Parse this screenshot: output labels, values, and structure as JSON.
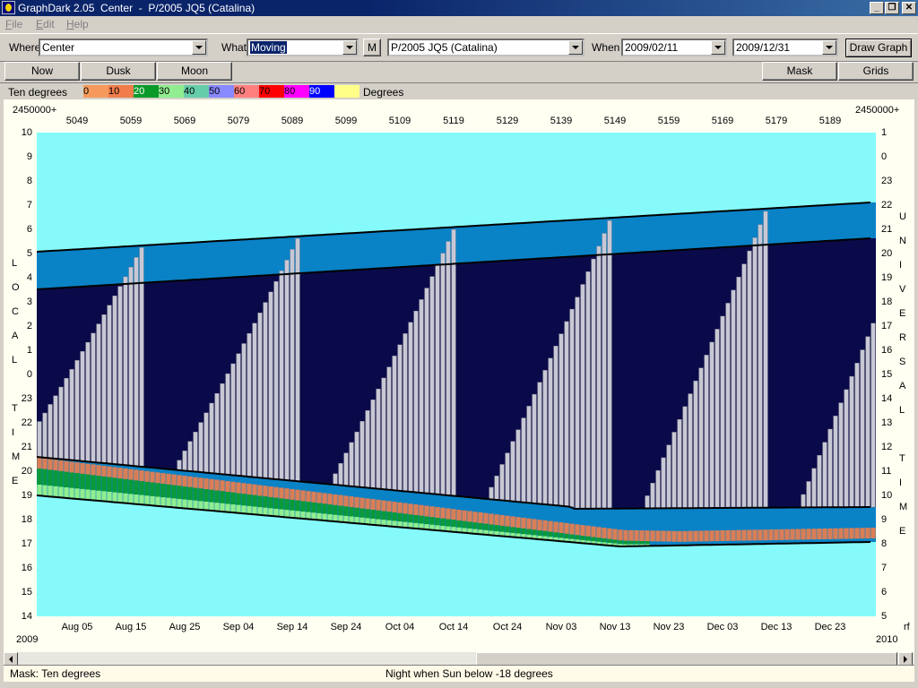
{
  "window": {
    "title": "GraphDark 2.05  Center  -  P/2005 JQ5 (Catalina)",
    "buttons": {
      "minimize": "_",
      "restore": "❐",
      "close": "✕"
    }
  },
  "menu": [
    "File",
    "Edit",
    "Help"
  ],
  "toolbar": {
    "where_label": "Where",
    "where_value": "Center",
    "what_label": "What",
    "what_value": "Moving",
    "m_button": "M",
    "object_value": "P/2005 JQ5 (Catalina)",
    "when_label": "When",
    "start_date": "2009/02/11",
    "end_date": "2009/12/31",
    "draw_button": "Draw Graph"
  },
  "toolbar2": {
    "now": "Now",
    "dusk": "Dusk",
    "moon": "Moon",
    "mask": "Mask",
    "grids": "Grids"
  },
  "legend": {
    "left_label": "Ten degrees",
    "right_label": "Degrees",
    "items": [
      {
        "label": "0",
        "color": "#f59a5c"
      },
      {
        "label": "10",
        "color": "#f07d4a"
      },
      {
        "label": "20",
        "color": "#0a9a2a"
      },
      {
        "label": "30",
        "color": "#90ee90"
      },
      {
        "label": "40",
        "color": "#66cdaa"
      },
      {
        "label": "50",
        "color": "#8888ff"
      },
      {
        "label": "60",
        "color": "#ff7f7f"
      },
      {
        "label": "70",
        "color": "#ff0000"
      },
      {
        "label": "80",
        "color": "#ff00ff"
      },
      {
        "label": "90",
        "color": "#0000ff"
      },
      {
        "label": "",
        "color": "#ffff88"
      }
    ]
  },
  "graph": {
    "top_left_label": "2450000+",
    "top_right_label": "2450000+",
    "jd_ticks": [
      "5049",
      "5059",
      "5069",
      "5079",
      "5089",
      "5099",
      "5109",
      "5119",
      "5129",
      "5139",
      "5149",
      "5159",
      "5169",
      "5179",
      "5189"
    ],
    "date_ticks": [
      "Aug 05",
      "Aug 15",
      "Aug 25",
      "Sep 04",
      "Sep 14",
      "Sep 24",
      "Oct 04",
      "Oct 14",
      "Oct 24",
      "Nov 03",
      "Nov 13",
      "Nov 23",
      "Dec 03",
      "Dec 13",
      "Dec 23"
    ],
    "year_left": "2009",
    "year_right": "2010",
    "right_corner": "rf",
    "left_hours": [
      "10",
      "9",
      "8",
      "7",
      "6",
      "5",
      "4",
      "3",
      "2",
      "1",
      "0",
      "23",
      "22",
      "21",
      "20",
      "19",
      "18",
      "17",
      "16",
      "15",
      "14"
    ],
    "right_hours": [
      "1",
      "0",
      "23",
      "22",
      "21",
      "20",
      "19",
      "18",
      "17",
      "16",
      "15",
      "14",
      "13",
      "12",
      "11",
      "10",
      "9",
      "8",
      "7",
      "6",
      "5"
    ],
    "left_vertical": [
      "L",
      "O",
      "C",
      "A",
      "L",
      "",
      "T",
      "I",
      "M",
      "E"
    ],
    "right_vertical": [
      "U",
      "N",
      "I",
      "V",
      "E",
      "R",
      "S",
      "A",
      "L",
      "",
      "T",
      "I",
      "M",
      "E"
    ],
    "colors": {
      "day": "#86fafa",
      "twilight": "#0a82c6",
      "night": "#0a0a4a",
      "object": "#c8c8d4",
      "band_orange": "#f07d4a",
      "band_green": "#0a9a3a",
      "band_lightgreen": "#90ee90"
    }
  },
  "status": {
    "mask": "Mask:  Ten degrees",
    "night": "Night when Sun below -18 degrees"
  }
}
